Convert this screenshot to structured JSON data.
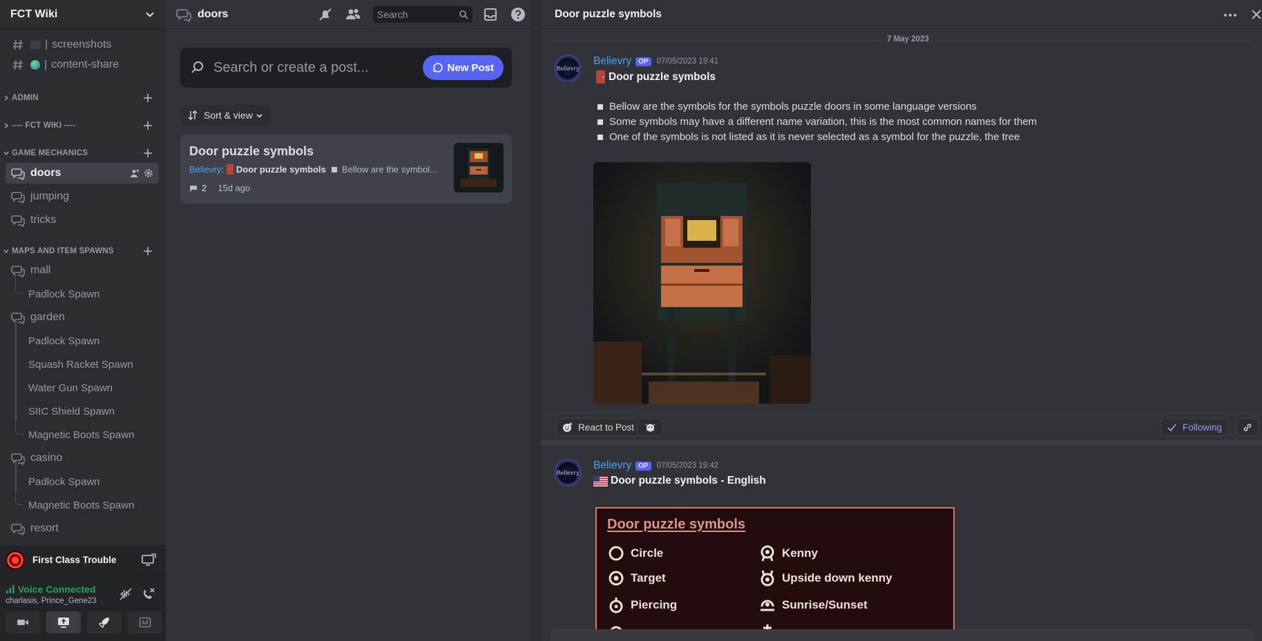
{
  "sidebar": {
    "server_name": "FCT Wiki",
    "channels_top": [
      {
        "label": "screenshots",
        "pipe": "|"
      },
      {
        "label": "content-share",
        "pipe": "|"
      }
    ],
    "categories": {
      "admin": "ADMIN",
      "fct_wiki": "---- FCT WIKI ----",
      "game_mechanics": "GAME MECHANICS",
      "maps": "MAPS AND ITEM SPAWNS"
    },
    "game_mechanics": [
      "doors",
      "jumping",
      "tricks"
    ],
    "maps": {
      "mall": "mall",
      "mall_threads": [
        "Padlock Spawn"
      ],
      "garden": "garden",
      "garden_threads": [
        "Padlock Spawn",
        "Squash Racket Spawn",
        "Water Gun Spawn",
        "SIIC Shield Spawn",
        "Magnetic Boots Spawn"
      ],
      "casino": "casino",
      "casino_threads": [
        "Padlock Spawn",
        "Magnetic Boots Spawn"
      ],
      "resort": "resort"
    },
    "game_activity": "First Class Trouble",
    "voice": {
      "status": "Voice Connected",
      "detail": "charlasis, Prince_Gene23"
    }
  },
  "forum": {
    "channel": "doors",
    "search_label": "Search",
    "search_placeholder": "Search or create a post...",
    "new_post": "New Post",
    "sort_label": "Sort & view",
    "post": {
      "title": "Door puzzle symbols",
      "author": "Believry",
      "colon": ":",
      "subtitle": "Door puzzle symbols",
      "preview": "Bellow are the symbol...",
      "replies": "2",
      "age": "15d ago"
    }
  },
  "thread": {
    "title": "Door puzzle symbols",
    "date_divider": "7 May 2023",
    "messages": [
      {
        "author": "Believry",
        "badge": "OP",
        "timestamp": "07/05/2023 19:41",
        "title": "Door puzzle symbols",
        "bullets": [
          "Bellow are the symbols for the symbols puzzle doors in some language versions",
          "Some symbols may have a different name variation, this is the most common names for them",
          "One of the symbols is not listed as it is never selected as a symbol for the puzzle, the tree"
        ]
      },
      {
        "author": "Believry",
        "badge": "OP",
        "timestamp": "07/05/2023 19:42",
        "title": "Door puzzle symbols - English"
      }
    ],
    "react_label": "React to Post",
    "following_label": "Following",
    "english_card": {
      "heading": "Door puzzle symbols",
      "left": [
        "Circle",
        "Target",
        "Piercing"
      ],
      "right": [
        "Kenny",
        "Upside down kenny",
        "Sunrise/Sunset"
      ]
    },
    "avatar_text": "Believry"
  },
  "colors": {
    "accent": "#5865f2",
    "username": "#4aa3f5",
    "voice_green": "#23a559",
    "following": "#949cf7"
  }
}
